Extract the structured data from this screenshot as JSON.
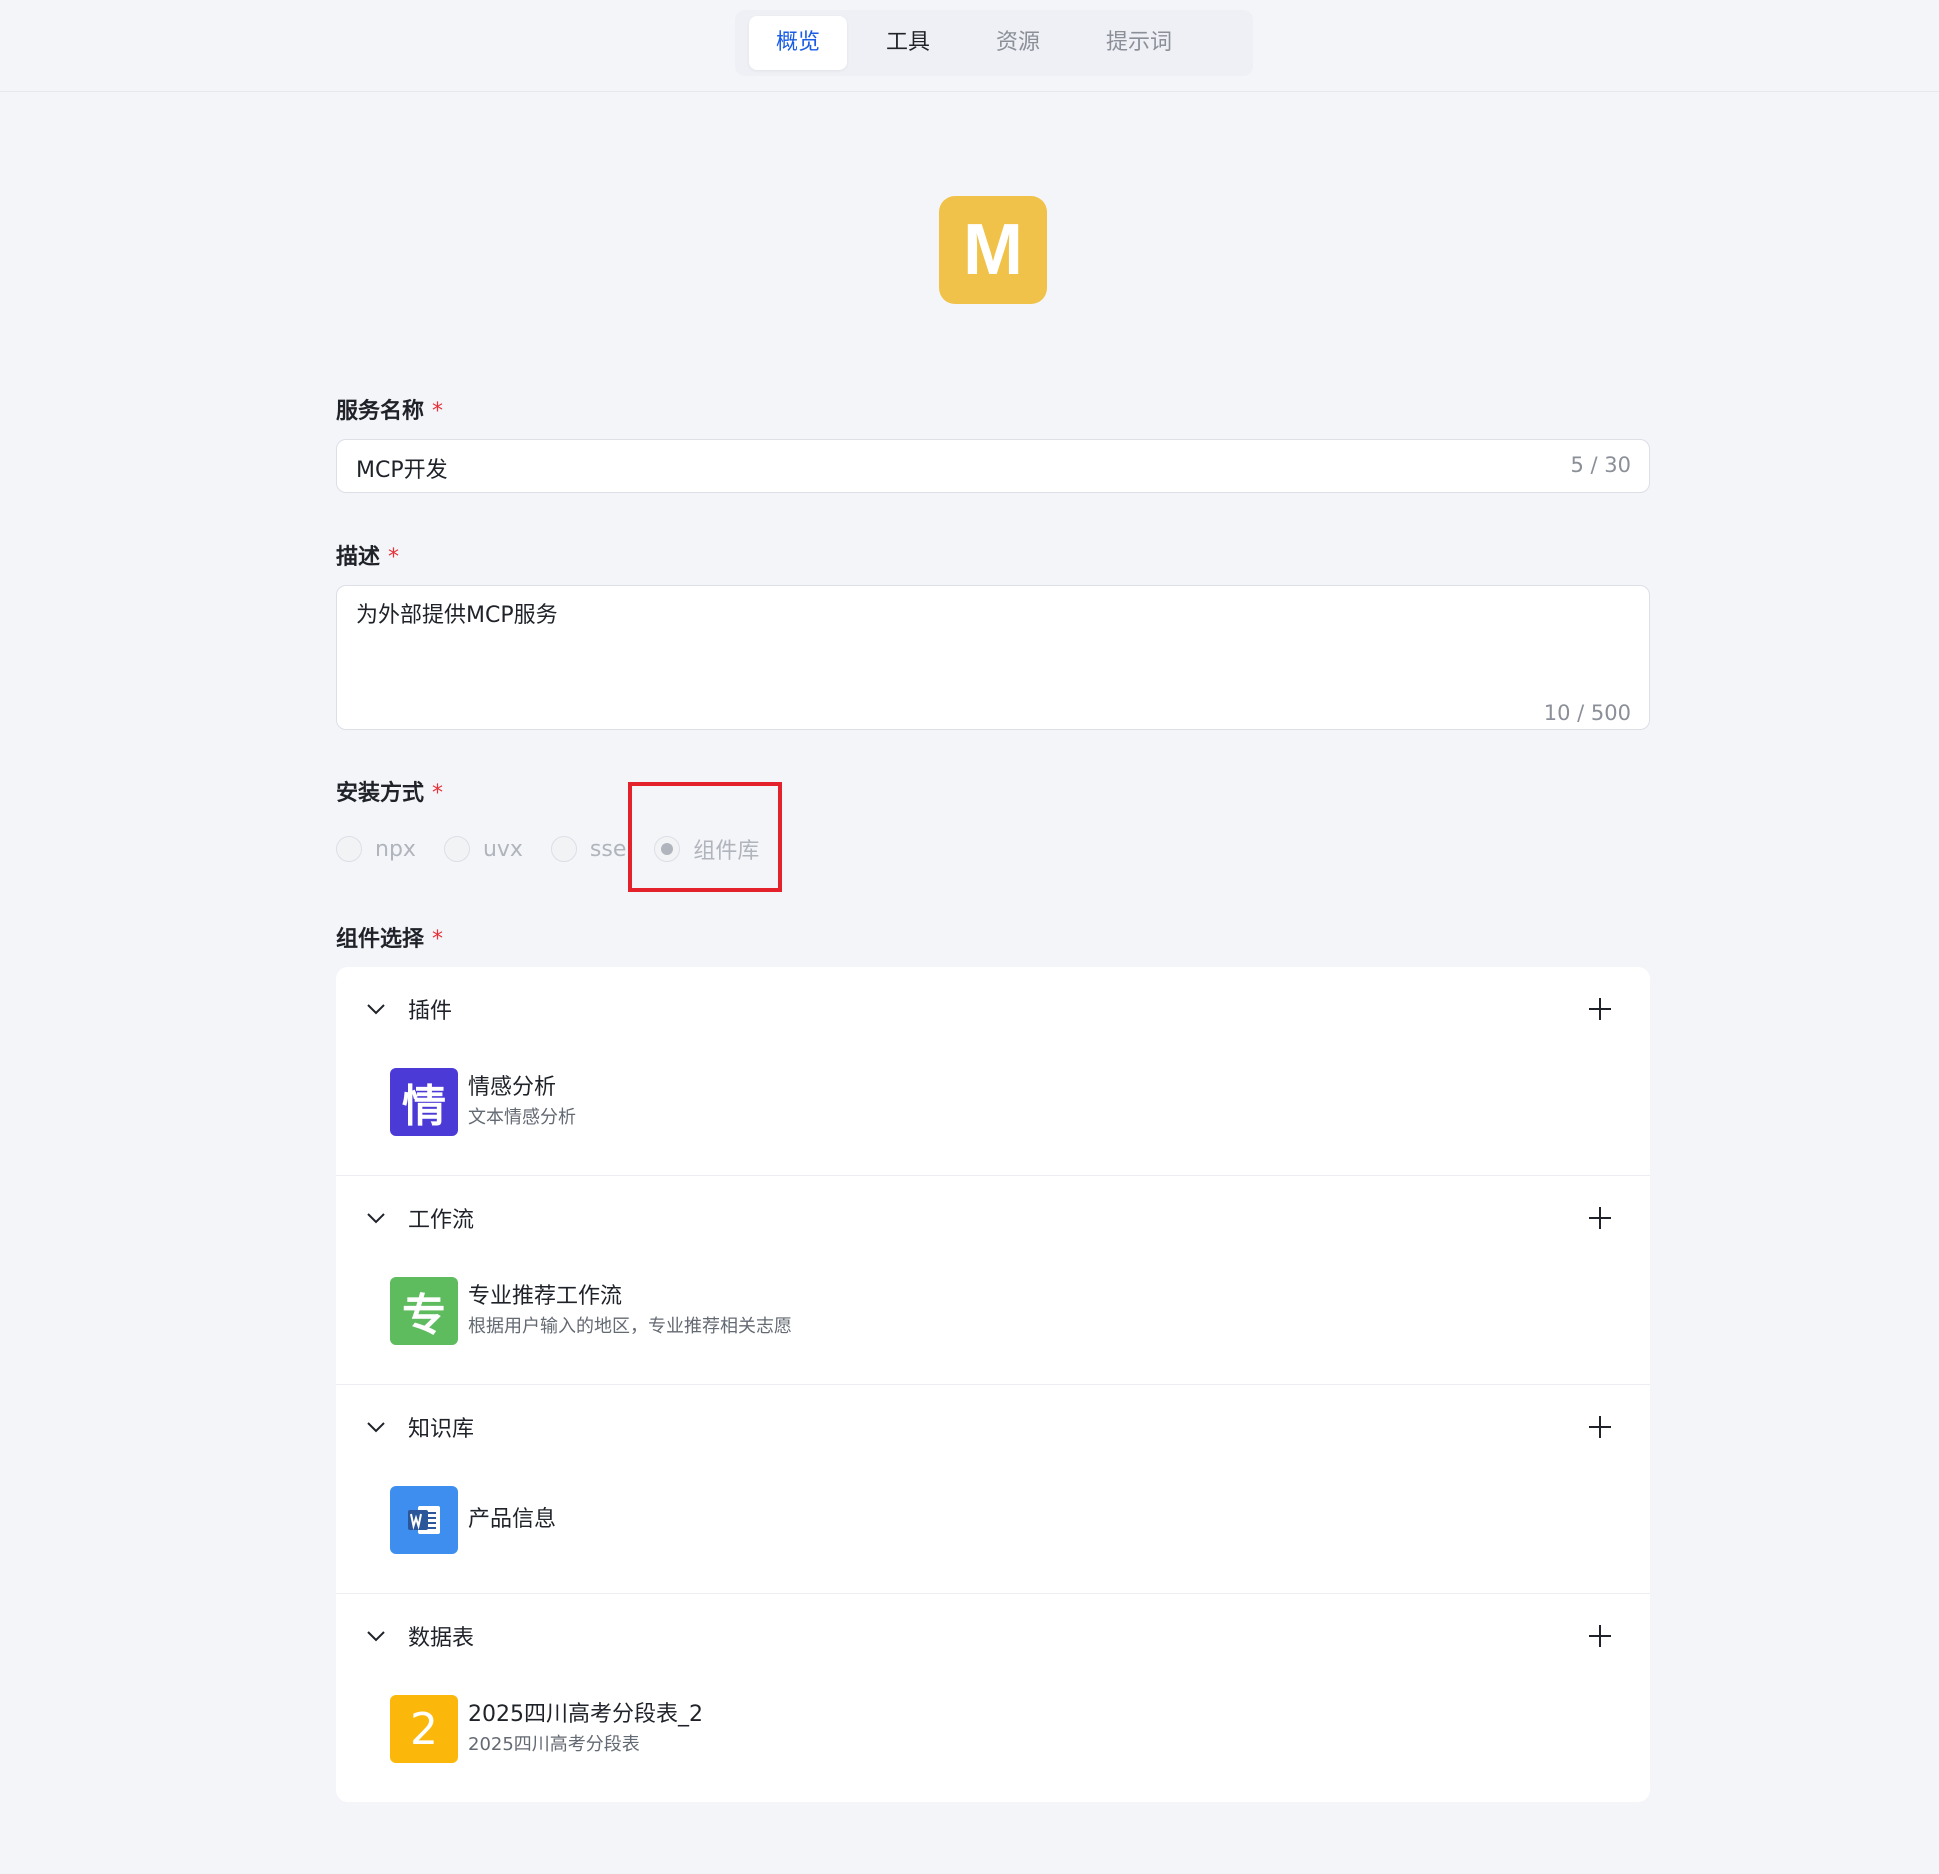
{
  "tabs": [
    {
      "label": "概览",
      "active": true
    },
    {
      "label": "工具",
      "active": false
    },
    {
      "label": "资源",
      "active": false
    },
    {
      "label": "提示词",
      "active": false
    }
  ],
  "avatar": {
    "letter": "M",
    "color": "#f0c24a"
  },
  "form": {
    "name": {
      "label": "服务名称",
      "required_mark": "*",
      "value": "MCP开发",
      "counter": "5 / 30"
    },
    "description": {
      "label": "描述",
      "required_mark": "*",
      "value": "为外部提供MCP服务",
      "counter": "10 / 500"
    },
    "install": {
      "label": "安装方式",
      "required_mark": "*",
      "options": [
        {
          "label": "npx",
          "selected": false
        },
        {
          "label": "uvx",
          "selected": false
        },
        {
          "label": "sse",
          "selected": false
        },
        {
          "label": "组件库",
          "selected": true
        }
      ]
    },
    "components": {
      "label": "组件选择",
      "required_mark": "*",
      "groups": [
        {
          "title": "插件",
          "item": {
            "icon_text": "情",
            "icon_color": "#4b3ad6",
            "title": "情感分析",
            "desc": "文本情感分析"
          }
        },
        {
          "title": "工作流",
          "item": {
            "icon_text": "专",
            "icon_color": "#5ebc5f",
            "title": "专业推荐工作流",
            "desc": "根据用户输入的地区，专业推荐相关志愿"
          }
        },
        {
          "title": "知识库",
          "item": {
            "icon_text": "",
            "icon_name": "word-doc-icon",
            "icon_color": "#3e8ef0",
            "title": "产品信息",
            "desc": ""
          }
        },
        {
          "title": "数据表",
          "item": {
            "icon_text": "2",
            "icon_color": "#fbb80a",
            "title": "2025四川高考分段表_2",
            "desc": "2025四川高考分段表"
          }
        }
      ]
    }
  },
  "colors": {
    "accent": "#1a5de5",
    "required": "#e5333a",
    "highlight": "#e3222b"
  }
}
